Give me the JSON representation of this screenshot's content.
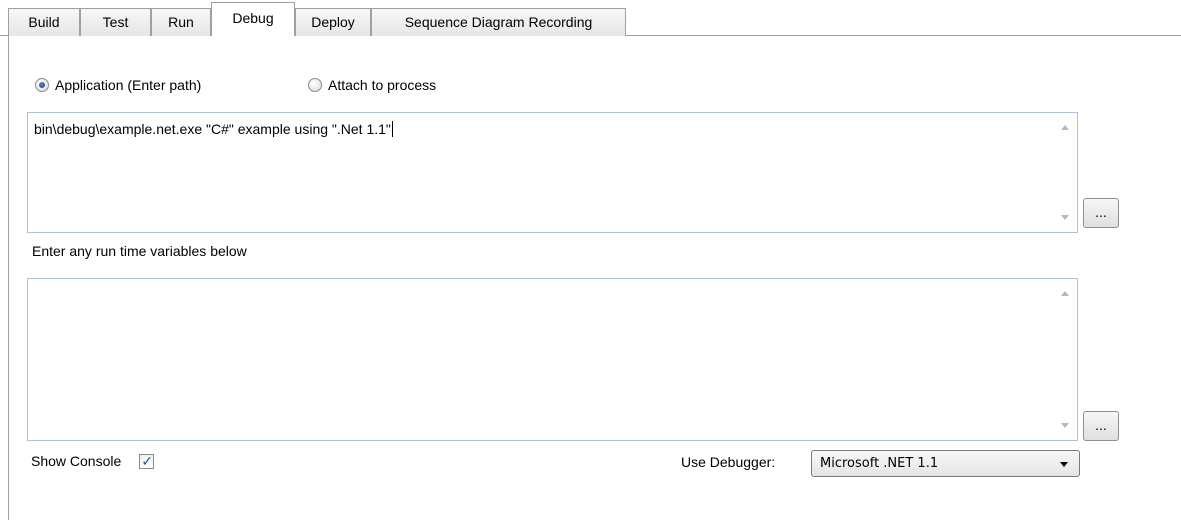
{
  "tabs": [
    {
      "label": "Build",
      "active": false
    },
    {
      "label": "Test",
      "active": false
    },
    {
      "label": "Run",
      "active": false
    },
    {
      "label": "Debug",
      "active": true
    },
    {
      "label": "Deploy",
      "active": false
    },
    {
      "label": "Sequence Diagram Recording",
      "active": false
    }
  ],
  "mode": {
    "application_label": "Application (Enter path)",
    "attach_label": "Attach to process",
    "selected": "application"
  },
  "application_path": {
    "value": "bin\\debug\\example.net.exe \"C#\" example using \".Net 1.1\"",
    "browse_label": "..."
  },
  "runtime_vars": {
    "hint": "Enter any run time variables below",
    "value": "",
    "browse_label": "..."
  },
  "show_console": {
    "label": "Show Console",
    "checked": true,
    "check_glyph": "✓"
  },
  "debugger": {
    "label": "Use Debugger:",
    "selected": "Microsoft .NET 1.1"
  },
  "icons": {
    "scroll_up": "scroll-up-arrow-icon",
    "scroll_down": "scroll-down-arrow-icon",
    "dropdown": "chevron-down-icon"
  },
  "colors": {
    "border": "#a0a0a0",
    "textbox_border": "#abc1de",
    "radio_fill": "#1c3f8a"
  }
}
